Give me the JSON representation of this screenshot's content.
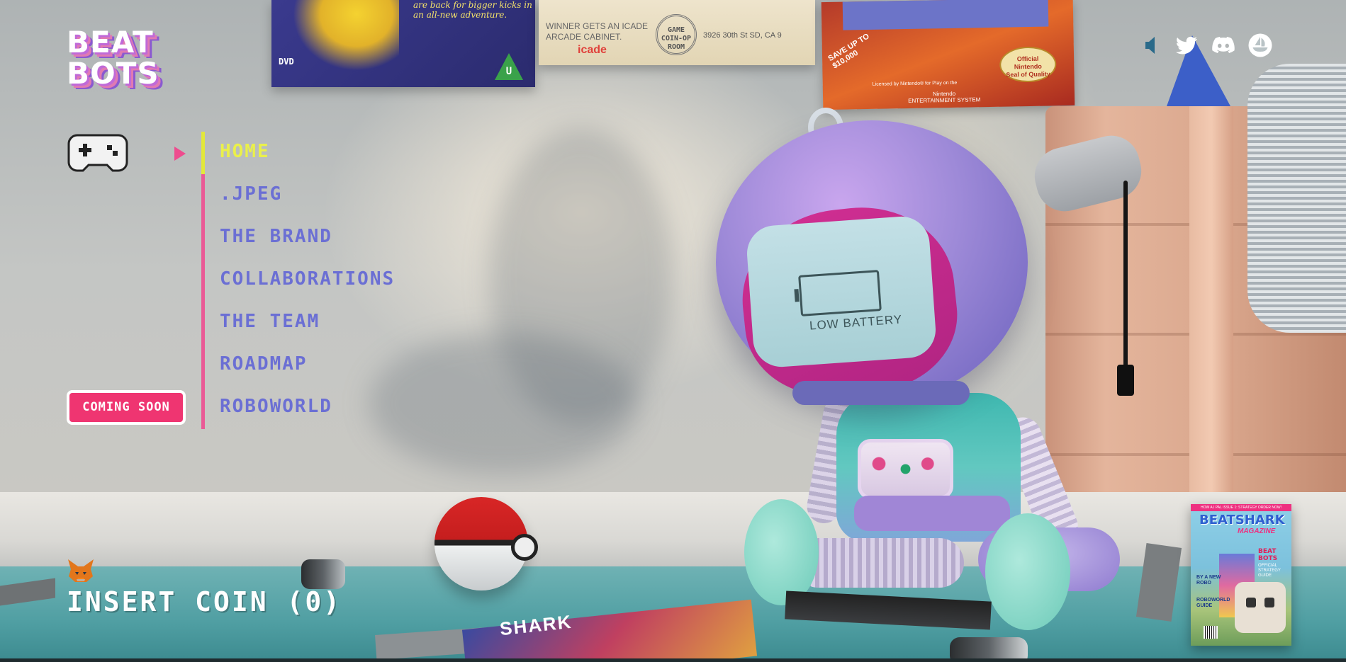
{
  "brand": {
    "logo_line1": "BEAT",
    "logo_line2": "BOTS"
  },
  "nav": {
    "items": [
      {
        "label": "HOME",
        "active": true
      },
      {
        "label": ".JPEG",
        "active": false
      },
      {
        "label": "THE BRAND",
        "active": false
      },
      {
        "label": "COLLABORATIONS",
        "active": false
      },
      {
        "label": "THE TEAM",
        "active": false
      },
      {
        "label": "ROADMAP",
        "active": false
      },
      {
        "label": "ROBOWORLD",
        "active": false
      }
    ],
    "coming_soon_label": "COMING SOON"
  },
  "header": {
    "icons": [
      "speaker-icon",
      "twitter-icon",
      "discord-icon",
      "opensea-icon"
    ]
  },
  "footer": {
    "insert_coin": "INSERT COIN (0)",
    "wallet_icon": "metamask-fox-icon"
  },
  "scene": {
    "robot_screen_text": "LOW BATTERY",
    "poster_dvd": {
      "text": "are back for bigger kicks in an all-new adventure.",
      "dvd_label": "DVD",
      "rating": "U"
    },
    "poster_coin": {
      "text_line1": "WINNER GETS AN ICADE",
      "text_line2": "ARCADE CABINET.",
      "logo": "icade",
      "seal_line1": "GAME",
      "seal_line2": "COIN-OP",
      "seal_line3": "ROOM",
      "address": "3926 30th St SD, CA 9"
    },
    "poster_nes": {
      "starburst_line1": "SAVE UP TO",
      "starburst_line2": "$10,000",
      "seal_line1": "Official",
      "seal_line2": "Nintendo",
      "seal_line3": "Seal of Quality",
      "license_text": "Licensed by Nintendo® for Play on the",
      "footer_line1": "Nintendo",
      "footer_line2": "ENTERTAINMENT SYSTEM"
    },
    "floor_magazine_title": "SHARK"
  },
  "magazine": {
    "top_strip": "HOW A.I PAL ISSUE 1: STRATEGY ORDER NOW!",
    "title": "BEATSHARK",
    "subtitle": "MAGAZINE",
    "side_title_line1": "BEAT",
    "side_title_line2": "BOTS",
    "side_sub_line1": "OFFICIAL",
    "side_sub_line2": "STRATEGY",
    "side_sub_line3": "GUIDE",
    "blurb1_line1": "BY A NEW",
    "blurb1_line2": "ROBO",
    "blurb2_line1": "ROBOWORLD",
    "blurb2_line2": "GUIDE"
  },
  "colors": {
    "nav_item": "#6b6fd4",
    "nav_active": "#eaf04a",
    "rail": "#ea5a96",
    "coming_soon_bg": "#ef3571"
  }
}
